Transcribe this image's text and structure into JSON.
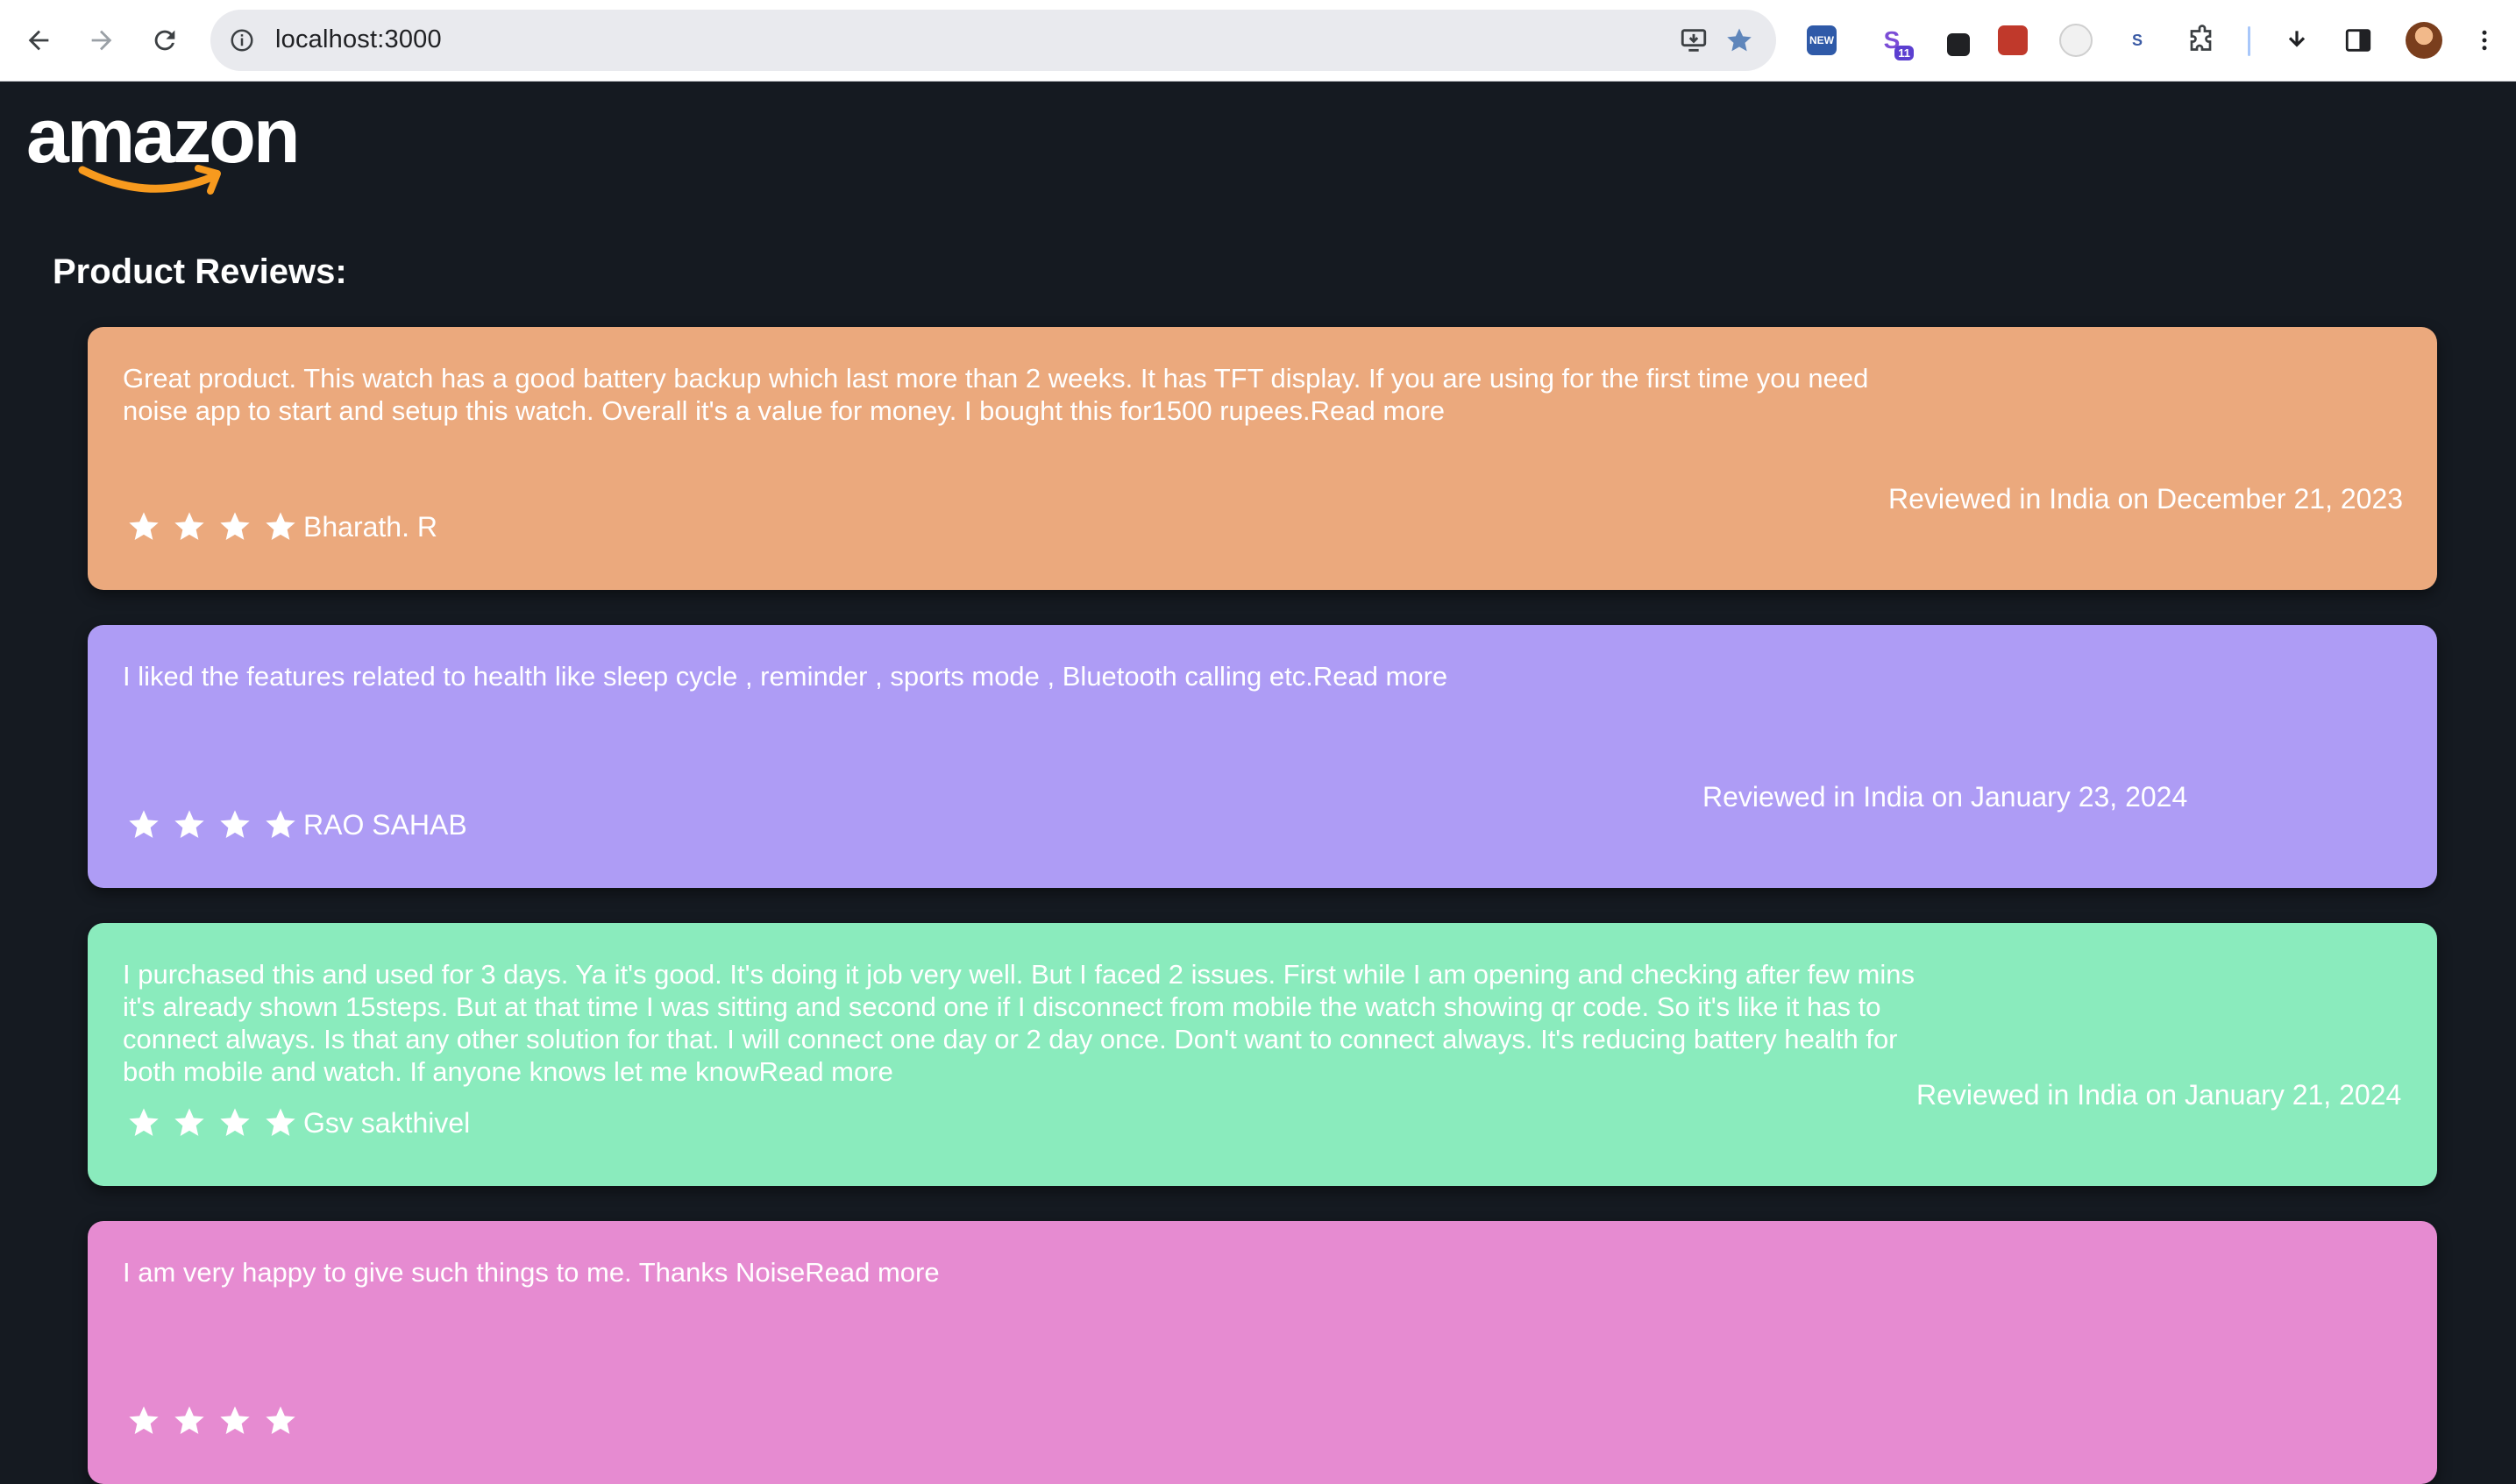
{
  "browser": {
    "url": "localhost:3000",
    "extensions": [
      {
        "icon": "new-badge-extension-icon",
        "label": "NEW",
        "color": "#2f5aa8"
      },
      {
        "icon": "s-extension-icon",
        "label": "S",
        "badge": "11",
        "color": "#7b4dd6"
      },
      {
        "icon": "dark-square-extension-icon",
        "color": "#202124"
      },
      {
        "icon": "red-extension-icon",
        "color": "#c0392b"
      },
      {
        "icon": "white-circle-extension-icon",
        "color": "#e8e8e8"
      },
      {
        "icon": "so-extension-icon",
        "color": "#3b5ba5"
      }
    ]
  },
  "page": {
    "logo_text": "amazon",
    "section_title": "Product Reviews:"
  },
  "reviews": [
    {
      "text": "Great product. This watch has a good battery backup which last more than 2 weeks. It has TFT display. If you are using for the first time you need noise app to start and setup this watch. Overall it's a value for money. I bought this for1500 rupees.Read more",
      "author": "Bharath. R",
      "date": "Reviewed in India on December 21, 2023",
      "rating": 4,
      "color": "#eba97d"
    },
    {
      "text": "I liked the features related to health like sleep cycle , reminder , sports mode , Bluetooth calling etc.Read more",
      "author": "RAO SAHAB",
      "date": "Reviewed in India on January 23, 2024",
      "rating": 4,
      "color": "#ae9cf5"
    },
    {
      "text": "I purchased this and used for 3 days. Ya it's good. It's doing it job very well. But I faced 2 issues. First while I am opening and checking after few mins it's already shown 15steps. But at that time I was sitting and second one if I disconnect from mobile the watch showing qr code. So it's like it has to connect always. Is that any other solution for that. I will connect one day or 2 day once. Don't want to connect always. It's reducing battery health for both mobile and watch. If anyone knows let me knowRead more",
      "author": "Gsv sakthivel",
      "date": "Reviewed in India on January 21, 2024",
      "rating": 4,
      "color": "#8aebbd"
    },
    {
      "text": "I am very happy to give such things to me. Thanks NoiseRead more",
      "author": "",
      "date": "",
      "rating": 4,
      "color": "#e68bd1"
    }
  ]
}
